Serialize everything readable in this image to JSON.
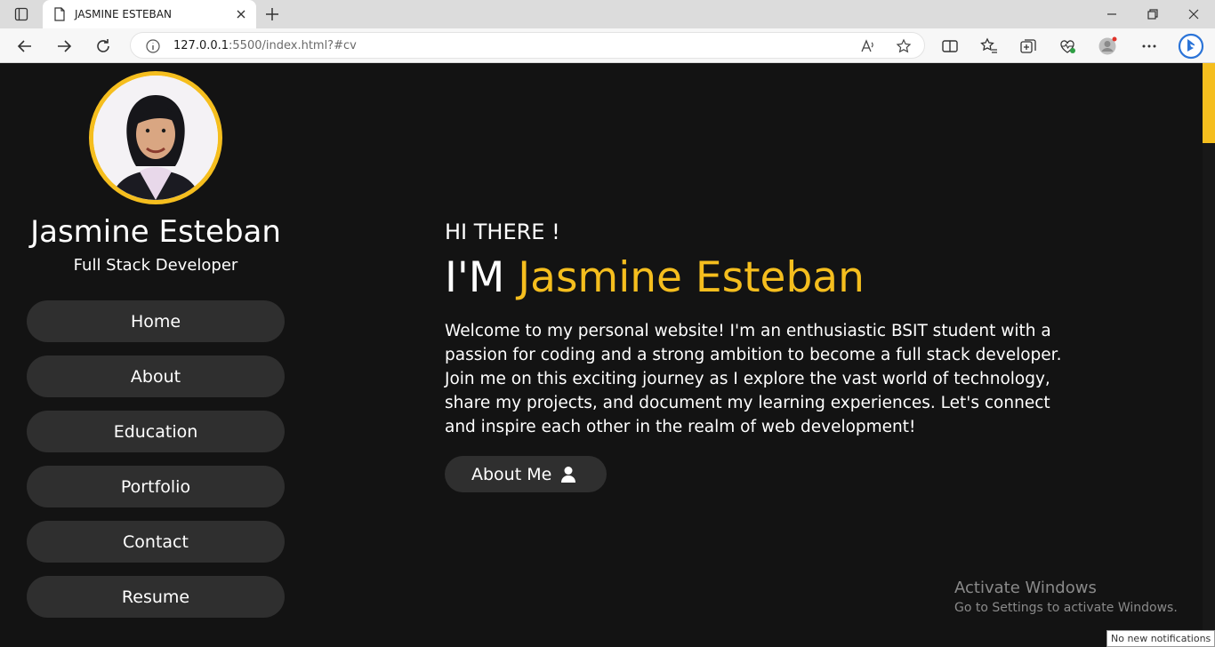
{
  "browser": {
    "tab_title": "JASMINE ESTEBAN",
    "url_host": "127.0.0.1",
    "url_rest": ":5500/index.html?#cv"
  },
  "profile": {
    "name": "Jasmine Esteban",
    "role": "Full Stack Developer"
  },
  "nav": [
    {
      "label": "Home"
    },
    {
      "label": "About"
    },
    {
      "label": "Education"
    },
    {
      "label": "Portfolio"
    },
    {
      "label": "Contact"
    },
    {
      "label": "Resume"
    }
  ],
  "hero": {
    "greeting": "HI THERE !",
    "prefix": "I'M ",
    "name": "Jasmine Esteban",
    "intro": "Welcome to my personal website! I'm an enthusiastic BSIT student with a passion for coding and a strong ambition to become a full stack developer. Join me on this exciting journey as I explore the vast world of technology, share my projects, and document my learning experiences. Let's connect and inspire each other in the realm of web development!",
    "button_label": "About Me"
  },
  "os": {
    "activate_title": "Activate Windows",
    "activate_sub": "Go to Settings to activate Windows.",
    "notification": "No new notifications"
  },
  "colors": {
    "accent": "#f5be1e",
    "background": "#131313",
    "button": "#2f2f2f"
  }
}
